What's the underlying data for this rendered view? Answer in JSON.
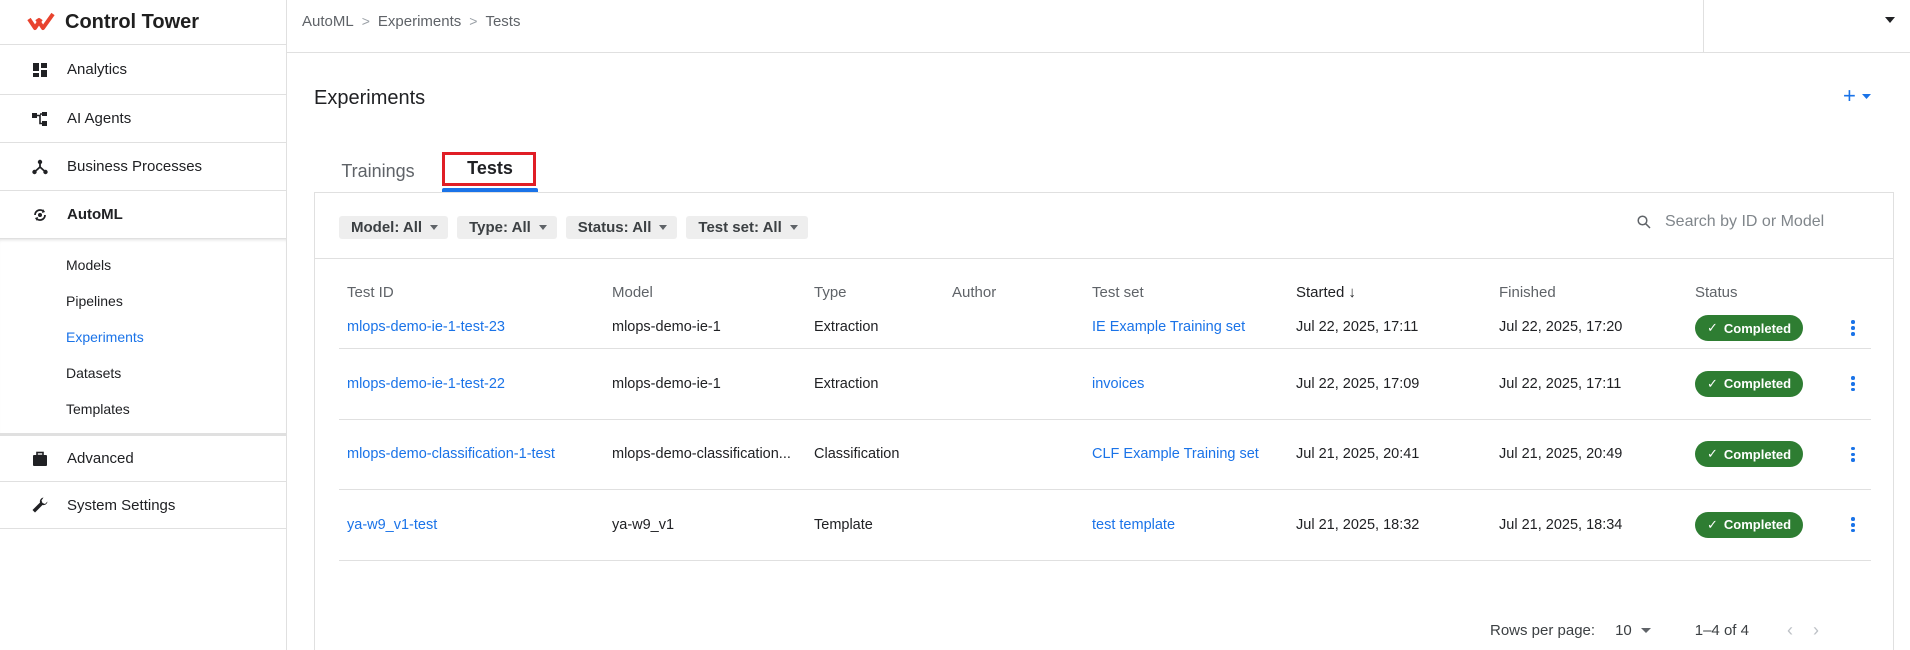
{
  "app": {
    "title": "Control Tower",
    "brand_color": "#e8432e"
  },
  "sidebar": {
    "items": [
      {
        "label": "Analytics",
        "icon": "dashboard-icon"
      },
      {
        "label": "AI Agents",
        "icon": "agents-icon"
      },
      {
        "label": "Business Processes",
        "icon": "process-icon"
      },
      {
        "label": "AutoML",
        "icon": "automl-icon"
      }
    ],
    "automl_sub": [
      "Models",
      "Pipelines",
      "Experiments",
      "Datasets",
      "Templates"
    ],
    "current_sub": "Experiments",
    "bottom_items": [
      {
        "label": "Advanced",
        "icon": "briefcase-icon"
      },
      {
        "label": "System Settings",
        "icon": "wrench-icon"
      }
    ]
  },
  "breadcrumb": [
    "AutoML",
    "Experiments",
    "Tests"
  ],
  "page": {
    "title": "Experiments",
    "add_label": "+"
  },
  "tabs": {
    "trainings": "Trainings",
    "tests": "Tests",
    "active": "Tests"
  },
  "filters": [
    "Model: All",
    "Type: All",
    "Status: All",
    "Test set: All"
  ],
  "search": {
    "placeholder": "Search by ID or Model",
    "value": ""
  },
  "table": {
    "columns": [
      "Test ID",
      "Model",
      "Type",
      "Author",
      "Test set",
      "Started",
      "Finished",
      "Status"
    ],
    "sort_column": "Started",
    "sort_arrow": "↓",
    "rows": [
      {
        "id": "mlops-demo-ie-1-test-23",
        "model": "mlops-demo-ie-1",
        "type": "Extraction",
        "author": "",
        "test_set": "IE Example Training set",
        "started": "Jul 22, 2025, 17:11",
        "finished": "Jul 22, 2025, 17:20",
        "status": "Completed"
      },
      {
        "id": "mlops-demo-ie-1-test-22",
        "model": "mlops-demo-ie-1",
        "type": "Extraction",
        "author": "",
        "test_set": "invoices",
        "started": "Jul 22, 2025, 17:09",
        "finished": "Jul 22, 2025, 17:11",
        "status": "Completed"
      },
      {
        "id": "mlops-demo-classification-1-test",
        "model": "mlops-demo-classification...",
        "type": "Classification",
        "author": "",
        "test_set": "CLF Example Training set",
        "started": "Jul 21, 2025, 20:41",
        "finished": "Jul 21, 2025, 20:49",
        "status": "Completed"
      },
      {
        "id": "ya-w9_v1-test",
        "model": "ya-w9_v1",
        "type": "Template",
        "author": "",
        "test_set": "test template",
        "started": "Jul 21, 2025, 18:32",
        "finished": "Jul 21, 2025, 18:34",
        "status": "Completed"
      }
    ]
  },
  "pagination": {
    "rows_per_page_label": "Rows per page:",
    "rows_per_page": "10",
    "range": "1–4 of 4"
  },
  "colors": {
    "link": "#1a73e8",
    "status_completed": "#2e7d32",
    "highlight": "#e01e26"
  }
}
